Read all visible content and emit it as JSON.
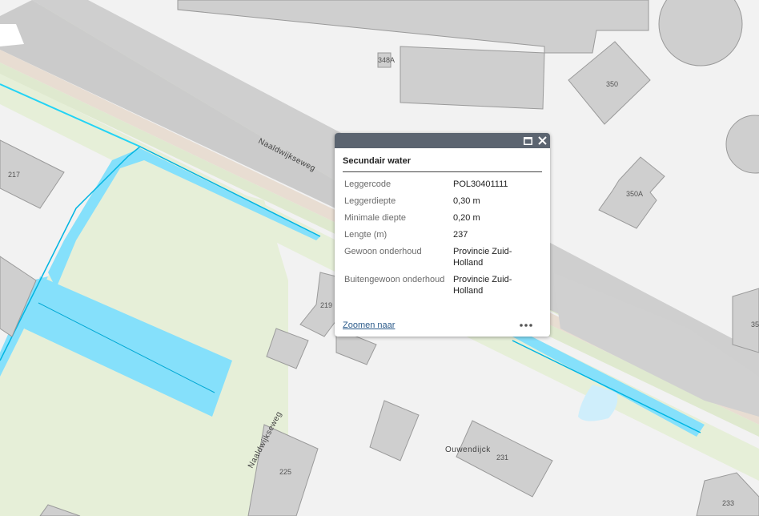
{
  "map": {
    "streets": [
      {
        "name": "Naaldwijkseweg"
      },
      {
        "name": "Naaldwijkseweg"
      },
      {
        "name": "Ouwendijck"
      }
    ],
    "house_numbers": [
      "348A",
      "350",
      "350A",
      "217",
      "219",
      "225",
      "231",
      "233",
      "35"
    ]
  },
  "popup": {
    "title": "Secundair water",
    "attributes": [
      {
        "label": "Leggercode",
        "value": "POL30401111"
      },
      {
        "label": "Leggerdiepte",
        "value": "0,30 m"
      },
      {
        "label": "Minimale diepte",
        "value": "0,20 m"
      },
      {
        "label": "Lengte (m)",
        "value": "237"
      },
      {
        "label": "Gewoon onderhoud",
        "value": "Provincie Zuid-Holland"
      },
      {
        "label": "Buitengewoon onderhoud",
        "value": "Provincie Zuid-Holland"
      }
    ],
    "zoom_link": "Zoomen naar",
    "icons": {
      "maximize": "maximize-icon",
      "close": "close-icon",
      "more": "more-icon"
    }
  },
  "colors": {
    "water": "#85e0fb",
    "water_line": "#00b5e2",
    "header": "#5b6470"
  }
}
